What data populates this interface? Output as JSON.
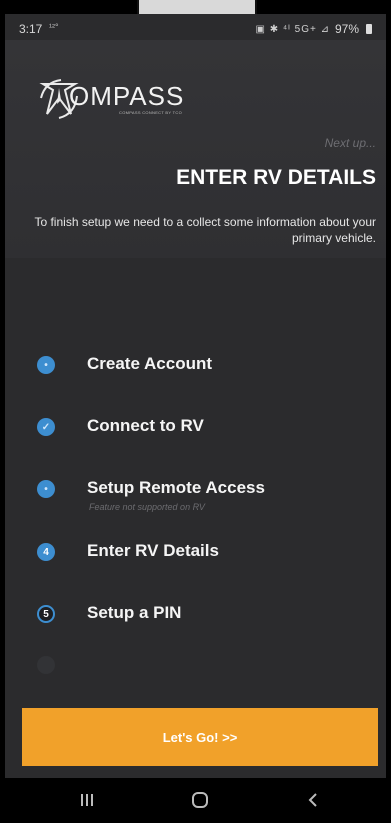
{
  "status_bar": {
    "time": "3:17",
    "notification": "¹²°",
    "system_icons": "▣ ✱ ⁴ᴵ 5G+ ⊿",
    "battery": "97%"
  },
  "header": {
    "logo_text": "OMPASS",
    "logo_sub": "COMPASS CONNECT BY TCO",
    "next_up": "Next up...",
    "title": "ENTER RV DETAILS",
    "description": "To finish setup we need to a collect some information about your primary vehicle."
  },
  "steps": [
    {
      "label": "Create Account",
      "marker": "•",
      "state": "done"
    },
    {
      "label": "Connect to RV",
      "marker": "✓",
      "state": "done"
    },
    {
      "label": "Setup Remote Access",
      "marker": "•",
      "state": "done",
      "note": "Feature not supported on RV"
    },
    {
      "label": "Enter RV Details",
      "marker": "4",
      "state": "current"
    },
    {
      "label": "Setup a PIN",
      "marker": "5",
      "state": "pending"
    }
  ],
  "cta": {
    "label": "Let's Go! >>"
  },
  "colors": {
    "accent": "#f1a12a",
    "step_blue": "#3d8ed0",
    "background": "#2b2b2d"
  },
  "nav": {
    "recents_icon": "recents-icon",
    "home_icon": "home-icon",
    "back_icon": "back-icon"
  }
}
